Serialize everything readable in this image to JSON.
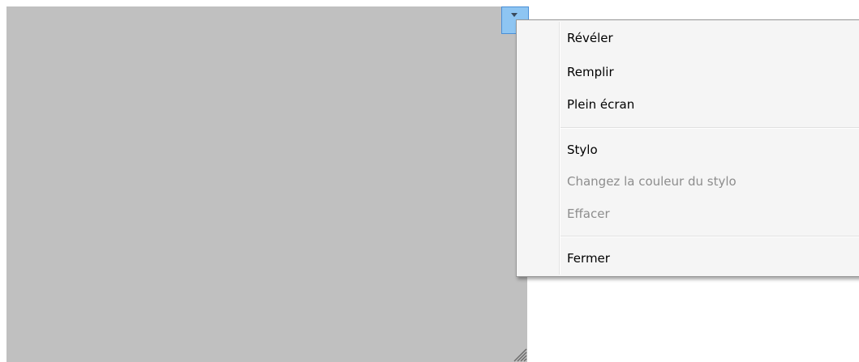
{
  "context_menu": {
    "items": [
      {
        "label": "Révéler",
        "enabled": true
      },
      {
        "label": "Remplir",
        "enabled": true
      },
      {
        "label": "Plein écran",
        "enabled": true
      },
      {
        "label": "Stylo",
        "enabled": true
      },
      {
        "label": "Changez la couleur du stylo",
        "enabled": false
      },
      {
        "label": "Effacer",
        "enabled": false
      },
      {
        "label": "Fermer",
        "enabled": true
      }
    ]
  },
  "colors": {
    "overlay": "#c0c0c0",
    "menu_background": "#f5f5f5",
    "menu_button": "#8ec5f2",
    "disabled_text": "#8d8d8d"
  },
  "icons": {
    "menu_button": "chevron-down-icon",
    "resize_grip": "resize-grip-icon"
  }
}
